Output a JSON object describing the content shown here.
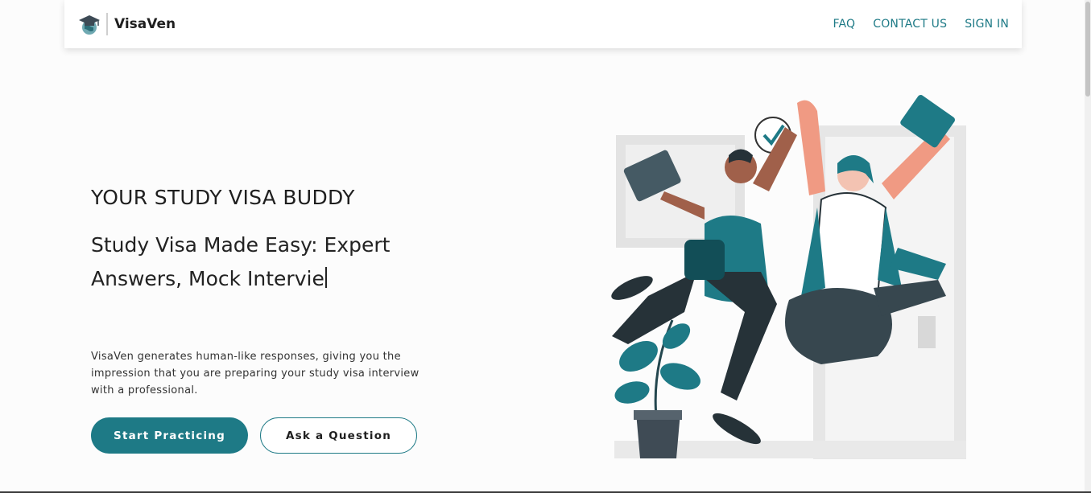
{
  "nav": {
    "brand": "VisaVen",
    "links": [
      "FAQ",
      "CONTACT US",
      "SIGN IN"
    ]
  },
  "hero": {
    "eyebrow": "YOUR STUDY VISA BUDDY",
    "title": "Study Visa Made Easy: Expert Answers, Mock Intervie",
    "description": "VisaVen generates human-like responses, giving you the impression that you are preparing your study visa interview with a professional.",
    "primary_button": "Start Practicing",
    "secondary_button": "Ask a Question"
  },
  "icons": {
    "logo": "graduation-cap-globe-icon",
    "illustration": "students-high-five-illustration"
  },
  "colors": {
    "accent": "#1e7a86",
    "background": "#fcfcfc",
    "text": "#222222"
  }
}
